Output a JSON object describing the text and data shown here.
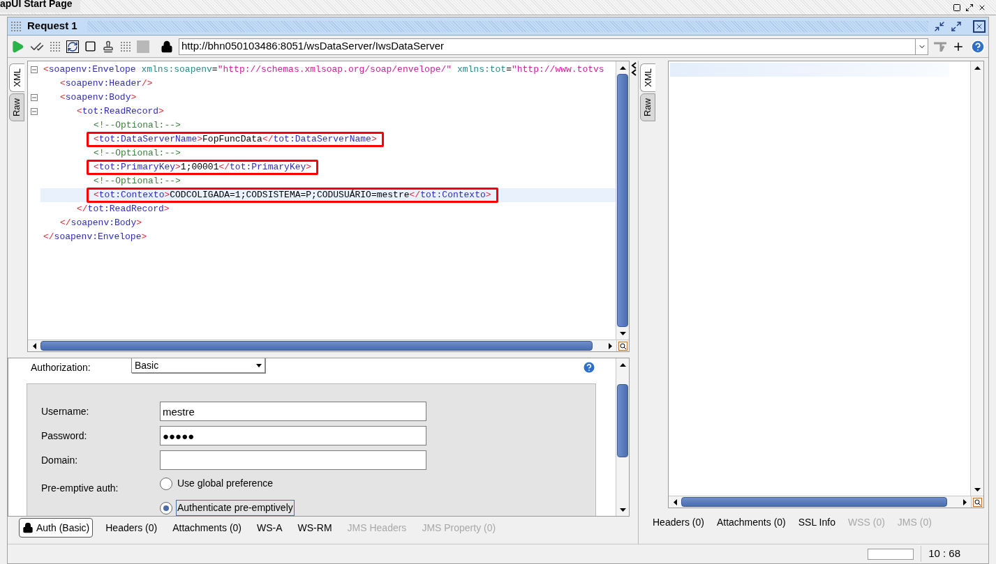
{
  "top_tab": {
    "title": "apUI Start Page"
  },
  "request": {
    "title": "Request 1",
    "url": "http://bhn050103486:8051/wsDataServer/IwsDataServer"
  },
  "request_editor": {
    "tabs": [
      {
        "label": "XML",
        "selected": true
      },
      {
        "label": "Raw",
        "selected": false
      }
    ],
    "xml": [
      {
        "tokens": [
          {
            "kind": "punct",
            "text": "<"
          },
          {
            "kind": "tag",
            "text": "soapenv:Envelope"
          },
          {
            "kind": "attr",
            "text": " xmlns:soapenv"
          },
          {
            "kind": "plain",
            "text": "="
          },
          {
            "kind": "value",
            "text": "\"http://schemas.xmlsoap.org/soap/envelope/\""
          },
          {
            "kind": "attr",
            "text": " xmlns:tot"
          },
          {
            "kind": "plain",
            "text": "="
          },
          {
            "kind": "value",
            "text": "\"http://www.totvs"
          }
        ],
        "expanded": true,
        "boxed": false,
        "current": false,
        "children": [
          {
            "tokens": [
              {
                "kind": "punct",
                "text": "<"
              },
              {
                "kind": "tag",
                "text": "soapenv:Header"
              },
              {
                "kind": "punct",
                "text": "/>"
              }
            ],
            "boxed": false,
            "current": false
          },
          {
            "tokens": [
              {
                "kind": "punct",
                "text": "<"
              },
              {
                "kind": "tag",
                "text": "soapenv:Body"
              },
              {
                "kind": "punct",
                "text": ">"
              }
            ],
            "expanded": true,
            "boxed": false,
            "current": false,
            "children": [
              {
                "tokens": [
                  {
                    "kind": "punct",
                    "text": "<"
                  },
                  {
                    "kind": "tag",
                    "text": "tot:ReadRecord"
                  },
                  {
                    "kind": "punct",
                    "text": ">"
                  }
                ],
                "expanded": true,
                "boxed": false,
                "current": false,
                "children": [
                  {
                    "tokens": [
                      {
                        "kind": "comment",
                        "text": "<!--Optional:-->"
                      }
                    ],
                    "boxed": false,
                    "current": false
                  },
                  {
                    "tokens": [
                      {
                        "kind": "punct",
                        "text": "<"
                      },
                      {
                        "kind": "tag",
                        "text": "tot:DataServerName"
                      },
                      {
                        "kind": "punct",
                        "text": ">"
                      },
                      {
                        "kind": "plain",
                        "text": "FopFuncData"
                      },
                      {
                        "kind": "punct",
                        "text": "</"
                      },
                      {
                        "kind": "tag",
                        "text": "tot:DataServerName"
                      },
                      {
                        "kind": "punct",
                        "text": ">"
                      }
                    ],
                    "boxed": true,
                    "current": false
                  },
                  {
                    "tokens": [
                      {
                        "kind": "comment",
                        "text": "<!--Optional:-->"
                      }
                    ],
                    "boxed": false,
                    "current": false
                  },
                  {
                    "tokens": [
                      {
                        "kind": "punct",
                        "text": "<"
                      },
                      {
                        "kind": "tag",
                        "text": "tot:PrimaryKey"
                      },
                      {
                        "kind": "punct",
                        "text": ">"
                      },
                      {
                        "kind": "plain",
                        "text": "1;00001"
                      },
                      {
                        "kind": "punct",
                        "text": "</"
                      },
                      {
                        "kind": "tag",
                        "text": "tot:PrimaryKey"
                      },
                      {
                        "kind": "punct",
                        "text": ">"
                      }
                    ],
                    "boxed": true,
                    "current": false
                  },
                  {
                    "tokens": [
                      {
                        "kind": "comment",
                        "text": "<!--Optional:-->"
                      }
                    ],
                    "boxed": false,
                    "current": false
                  },
                  {
                    "tokens": [
                      {
                        "kind": "punct",
                        "text": "<"
                      },
                      {
                        "kind": "tag",
                        "text": "tot:Contexto"
                      },
                      {
                        "kind": "punct",
                        "text": ">"
                      },
                      {
                        "kind": "plain",
                        "text": "CODCOLIGADA=1;CODSISTEMA=P;CODUSUÁRIO=mestre"
                      },
                      {
                        "kind": "punct",
                        "text": "</"
                      },
                      {
                        "kind": "tag",
                        "text": "tot:Contexto"
                      },
                      {
                        "kind": "punct",
                        "text": ">"
                      }
                    ],
                    "boxed": true,
                    "current": true
                  }
                ],
                "closing": [
                  {
                    "kind": "punct",
                    "text": "</"
                  },
                  {
                    "kind": "tag",
                    "text": "tot:ReadRecord"
                  },
                  {
                    "kind": "punct",
                    "text": ">"
                  }
                ]
              }
            ],
            "closing": [
              {
                "kind": "punct",
                "text": "</"
              },
              {
                "kind": "tag",
                "text": "soapenv:Body"
              },
              {
                "kind": "punct",
                "text": ">"
              }
            ]
          }
        ],
        "closing": [
          {
            "kind": "punct",
            "text": "</"
          },
          {
            "kind": "tag",
            "text": "soapenv:Envelope"
          },
          {
            "kind": "punct",
            "text": ">"
          }
        ]
      }
    ]
  },
  "auth": {
    "label": "Authorization:",
    "type": "Basic",
    "fields": [
      {
        "label": "Username:",
        "value": "mestre"
      },
      {
        "label": "Password:",
        "value": "●●●●●"
      },
      {
        "label": "Domain:"
      }
    ],
    "preemptive": {
      "label": "Pre-emptive auth:",
      "options": [
        {
          "label": "Use global preference",
          "selected": false
        },
        {
          "label": "Authenticate pre-emptively",
          "selected": true
        }
      ]
    }
  },
  "request_tabs": [
    {
      "label": "Auth (Basic)",
      "selected": true,
      "disabled": false
    },
    {
      "label": "Headers (0)",
      "selected": false,
      "disabled": false
    },
    {
      "label": "Attachments (0)",
      "selected": false,
      "disabled": false
    },
    {
      "label": "WS-A",
      "selected": false,
      "disabled": false
    },
    {
      "label": "WS-RM",
      "selected": false,
      "disabled": false
    },
    {
      "label": "JMS Headers",
      "selected": false,
      "disabled": true
    },
    {
      "label": "JMS Property (0)",
      "selected": false,
      "disabled": true
    }
  ],
  "response_editor": {
    "tabs": [
      {
        "label": "XML",
        "selected": true
      },
      {
        "label": "Raw",
        "selected": false
      }
    ]
  },
  "response_tabs": [
    {
      "label": "Headers (0)",
      "disabled": false
    },
    {
      "label": "Attachments (0)",
      "disabled": false
    },
    {
      "label": "SSL Info",
      "disabled": false
    },
    {
      "label": "WSS (0)",
      "disabled": true
    },
    {
      "label": "JMS (0)",
      "disabled": true
    }
  ],
  "status_bar": {
    "position": "10 : 68"
  }
}
